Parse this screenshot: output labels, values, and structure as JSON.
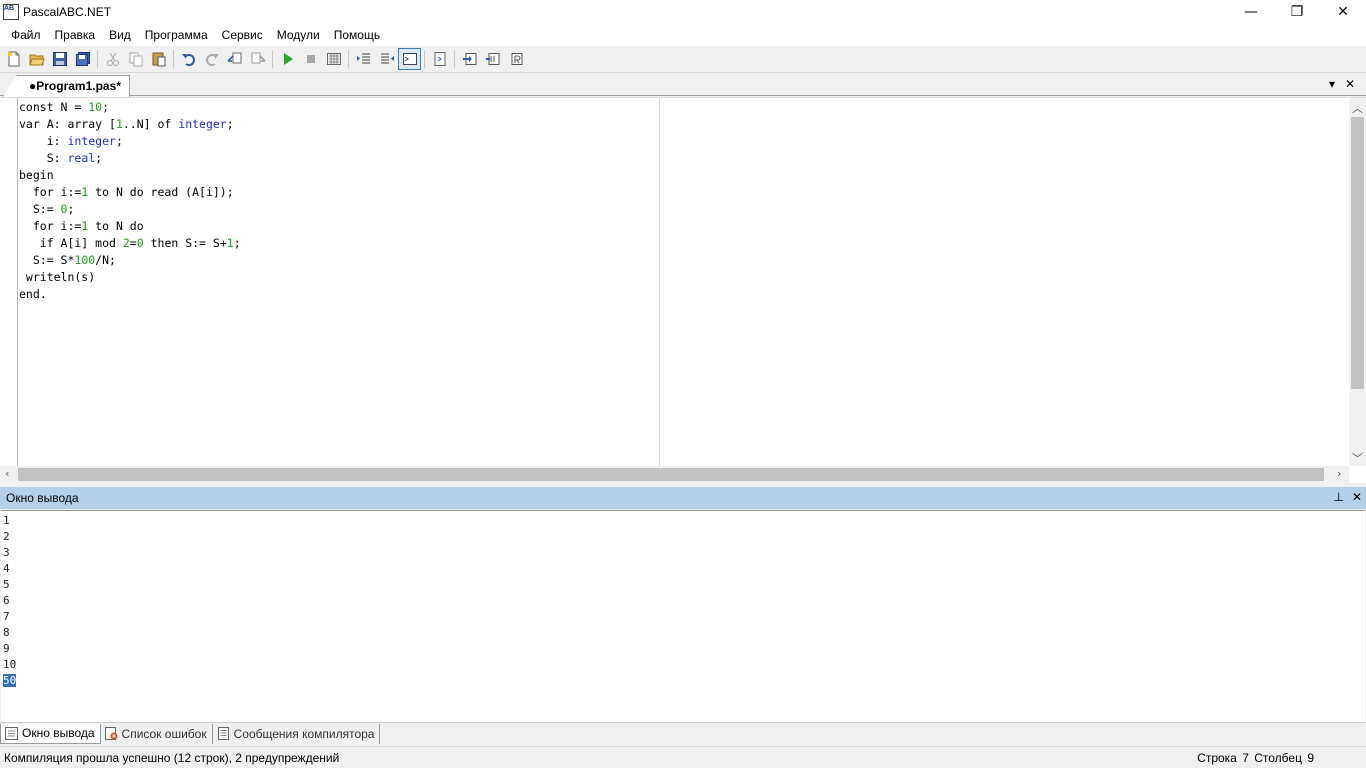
{
  "window": {
    "title": "PascalABC.NET",
    "icon_text": "AB",
    "minimize": "—",
    "maximize": "❐",
    "close": "✕"
  },
  "menu": [
    "Файл",
    "Правка",
    "Вид",
    "Программа",
    "Сервис",
    "Модули",
    "Помощь"
  ],
  "toolbar_icons": [
    "new-file-icon",
    "open-folder-icon",
    "save-icon",
    "save-all-icon",
    "cut-icon",
    "copy-icon",
    "paste-icon",
    "undo-icon",
    "redo-icon",
    "comment-icon",
    "uncomment-icon",
    "run-icon",
    "stop-icon",
    "compile-icon",
    "indent-icon",
    "unindent-icon",
    "output-window-icon",
    "debug-icon",
    "step-into-icon",
    "step-over-icon",
    "step-out-icon"
  ],
  "editor": {
    "tab_label": "●Program1.pas*",
    "tab_dropdown": "▾",
    "tab_close": "✕",
    "code": [
      [
        {
          "t": "const N = "
        },
        {
          "t": "10",
          "c": "num"
        },
        {
          "t": ";"
        }
      ],
      [
        {
          "t": "var A: array ["
        },
        {
          "t": "1",
          "c": "num"
        },
        {
          "t": "..N] of "
        },
        {
          "t": "integer",
          "c": "type"
        },
        {
          "t": ";"
        }
      ],
      [
        {
          "t": "    i: "
        },
        {
          "t": "integer",
          "c": "type"
        },
        {
          "t": ";"
        }
      ],
      [
        {
          "t": "    S: "
        },
        {
          "t": "real",
          "c": "type"
        },
        {
          "t": ";"
        }
      ],
      [
        {
          "t": "begin"
        }
      ],
      [
        {
          "t": "  for i:="
        },
        {
          "t": "1",
          "c": "num"
        },
        {
          "t": " to N do read (A[i]);"
        }
      ],
      [
        {
          "t": "  S:= "
        },
        {
          "t": "0",
          "c": "num"
        },
        {
          "t": ";"
        }
      ],
      [
        {
          "t": "  for i:="
        },
        {
          "t": "1",
          "c": "num"
        },
        {
          "t": " to N do"
        }
      ],
      [
        {
          "t": "   if A[i] mod "
        },
        {
          "t": "2",
          "c": "num"
        },
        {
          "t": "="
        },
        {
          "t": "0",
          "c": "num"
        },
        {
          "t": " then S:= S+"
        },
        {
          "t": "1",
          "c": "num"
        },
        {
          "t": ";"
        }
      ],
      [
        {
          "t": "  S:= S*"
        },
        {
          "t": "100",
          "c": "num"
        },
        {
          "t": "/N;"
        }
      ],
      [
        {
          "t": " writeln(s)"
        }
      ],
      [
        {
          "t": "end."
        }
      ]
    ]
  },
  "output": {
    "title": "Окно вывода",
    "pin": "⊥",
    "close": "✕",
    "lines": [
      "1",
      "2",
      "3",
      "4",
      "5",
      "6",
      "7",
      "8",
      "9",
      "10"
    ],
    "selected_line": "50"
  },
  "bottom_tabs": [
    "Окно вывода",
    "Список ошибок",
    "Сообщения компилятора"
  ],
  "status": {
    "message": "Компиляция прошла успешно (12 строк), 2 предупреждений",
    "line_label": "Строка",
    "line": "7",
    "col_label": "Столбец",
    "col": "9"
  },
  "colors": {
    "number": "#1e9b1e",
    "type": "#1c2fd6",
    "output_header": "#b4cfe8",
    "selection": "#3170b8"
  }
}
